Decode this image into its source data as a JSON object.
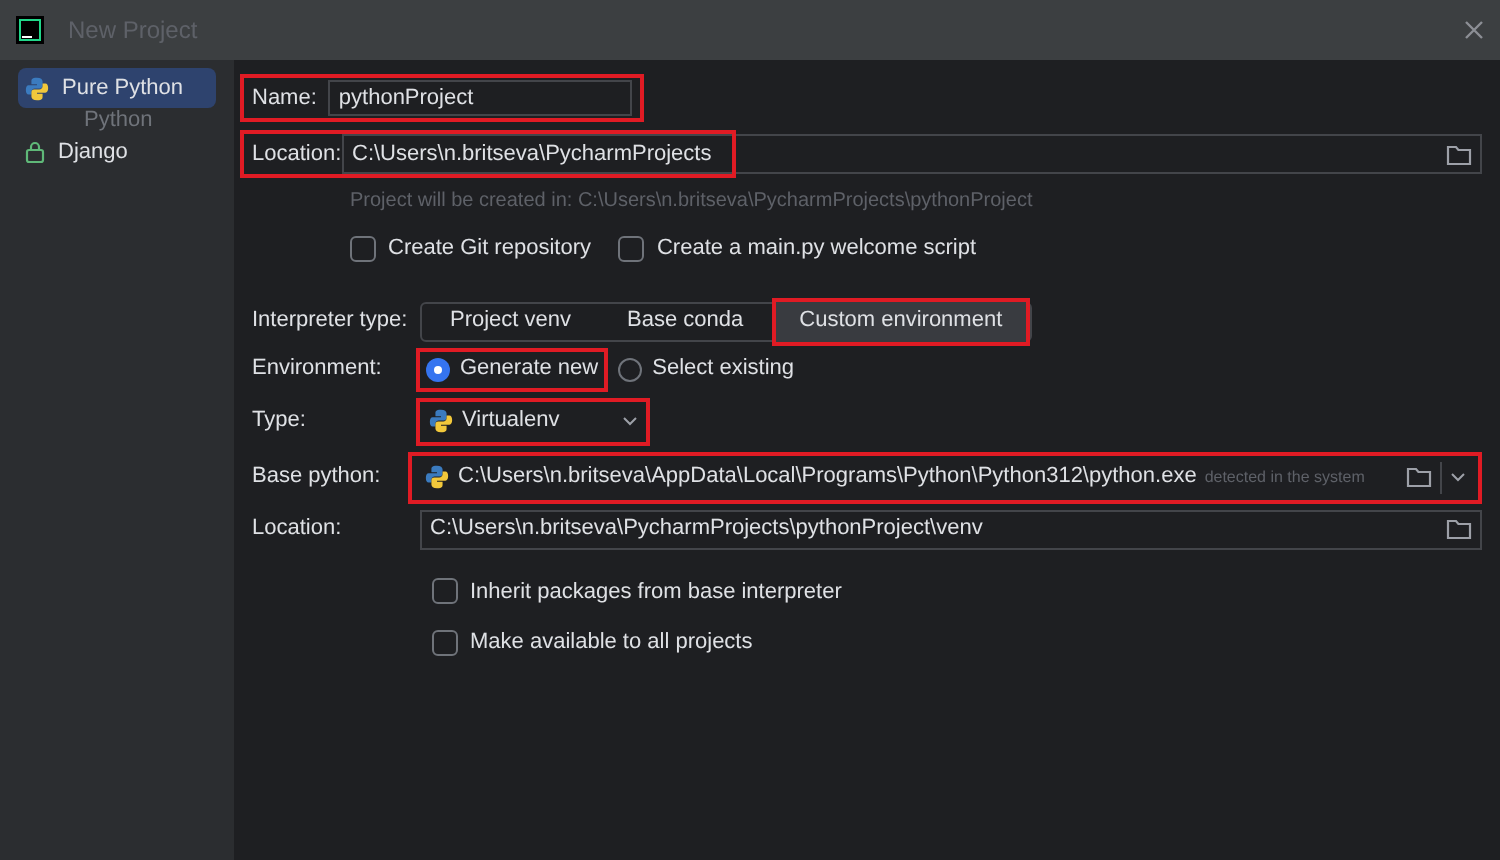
{
  "window": {
    "title": "New Project"
  },
  "sidebar": {
    "items": [
      {
        "kind": "python",
        "label": "Pure Python",
        "selected": true
      },
      {
        "kind": "header",
        "label": "Python",
        "selected": false
      },
      {
        "kind": "locked",
        "label": "Django",
        "selected": false
      }
    ]
  },
  "form": {
    "name": {
      "label": "Name:",
      "value": "pythonProject",
      "highlighted": true
    },
    "location": {
      "label": "Location:",
      "value": "C:\\Users\\n.britseva\\PycharmProjects",
      "highlighted": true
    },
    "hint": "Project will be created in: C:\\Users\\n.britseva\\PycharmProjects\\pythonProject",
    "checkboxes": [
      {
        "label": "Create Git repository",
        "checked": false
      },
      {
        "label": "Create a main.py welcome script",
        "checked": false
      }
    ],
    "interpreter_type": {
      "label": "Interpreter type:",
      "options": [
        {
          "label": "Project venv",
          "selected": false,
          "highlighted": false
        },
        {
          "label": "Base conda",
          "selected": false,
          "highlighted": false
        },
        {
          "label": "Custom environment",
          "selected": true,
          "highlighted": true
        }
      ]
    },
    "environment": {
      "label": "Environment:",
      "options": [
        {
          "label": "Generate new",
          "selected": true,
          "highlighted": true
        },
        {
          "label": "Select existing",
          "selected": false,
          "highlighted": false
        }
      ]
    },
    "type": {
      "label": "Type:",
      "value": "Virtualenv",
      "highlighted": true
    },
    "base_python": {
      "label": "Base python:",
      "value": "C:\\Users\\n.britseva\\AppData\\Local\\Programs\\Python\\Python312\\python.exe",
      "note": "detected in the system",
      "highlighted": true
    },
    "venv_location": {
      "label": "Location:",
      "value": "C:\\Users\\n.britseva\\PycharmProjects\\pythonProject\\venv"
    },
    "options": [
      {
        "label": "Inherit packages from base interpreter",
        "checked": false
      },
      {
        "label": "Make available to all projects",
        "checked": false
      }
    ]
  }
}
